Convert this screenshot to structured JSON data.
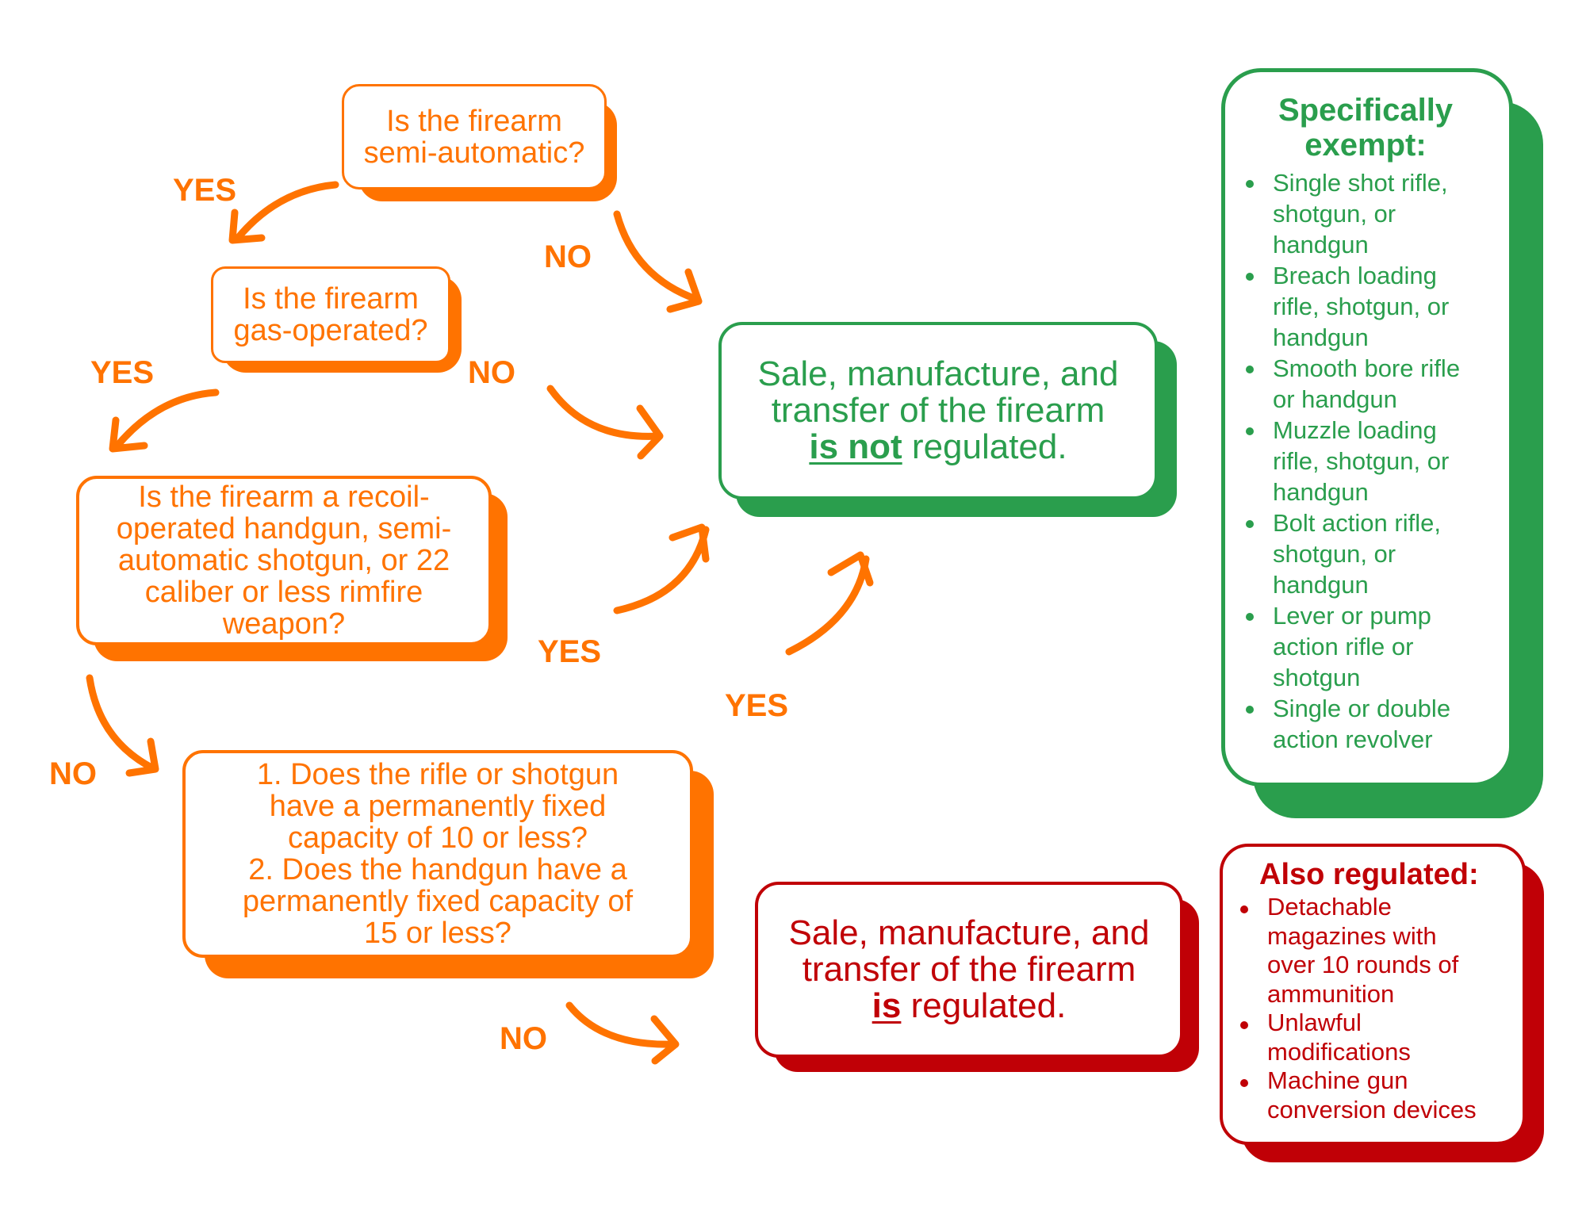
{
  "colors": {
    "orange": "#ff7300",
    "green": "#2a9e4d",
    "red": "#c00006"
  },
  "questions": {
    "q1": [
      "Is the firearm",
      "semi-automatic?"
    ],
    "q2": [
      "Is the firearm",
      "gas-operated?"
    ],
    "q3": [
      "Is the firearm a recoil-",
      "operated handgun, semi-",
      "automatic shotgun, or 22",
      "caliber or less rimfire",
      "weapon?"
    ],
    "q4": [
      "1. Does the rifle or shotgun",
      "have a permanently fixed",
      "capacity of 10 or less?",
      "2. Does the handgun have a",
      "permanently fixed capacity of",
      "15 or less?"
    ]
  },
  "results": {
    "not_regulated": {
      "line1": "Sale, manufacture, and",
      "line2": "transfer of the firearm",
      "emphasis": "is not",
      "tail": " regulated."
    },
    "regulated": {
      "line1": "Sale, manufacture, and",
      "line2": "transfer of the firearm",
      "emphasis": "is",
      "tail": " regulated."
    }
  },
  "labels": {
    "q1_yes": "YES",
    "q1_no": "NO",
    "q2_yes": "YES",
    "q2_no": "NO",
    "q3_yes": "YES",
    "q3_no": "NO",
    "q4_yes": "YES",
    "q4_no": "NO"
  },
  "exempt": {
    "title_line1": "Specifically",
    "title_line2": "exempt:",
    "items": [
      [
        "Single shot rifle,",
        "shotgun, or",
        "handgun"
      ],
      [
        "Breach loading",
        "rifle, shotgun, or",
        "handgun"
      ],
      [
        "Smooth bore rifle",
        "or handgun"
      ],
      [
        "Muzzle loading",
        "rifle, shotgun, or",
        "handgun"
      ],
      [
        "Bolt action rifle,",
        "shotgun, or",
        "handgun"
      ],
      [
        "Lever or pump",
        "action rifle or",
        "shotgun"
      ],
      [
        "Single or double",
        "action revolver"
      ]
    ]
  },
  "also_regulated": {
    "title": "Also regulated:",
    "items": [
      [
        "Detachable",
        "magazines with",
        "over 10 rounds of",
        "ammunition"
      ],
      [
        "Unlawful",
        "modifications"
      ],
      [
        "Machine gun",
        "conversion devices"
      ]
    ]
  }
}
